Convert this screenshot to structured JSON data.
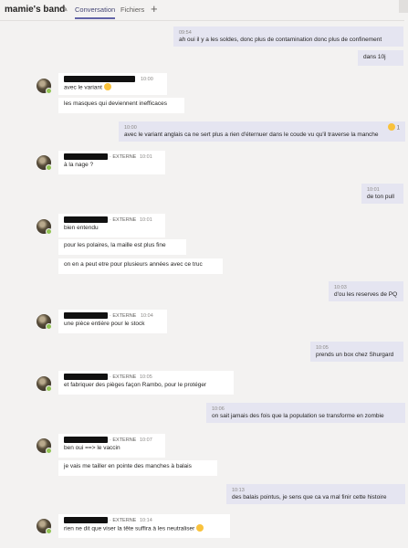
{
  "header": {
    "title": "mamie's band",
    "tabs": [
      {
        "label": "Conversation",
        "active": true
      },
      {
        "label": "Fichiers",
        "active": false
      }
    ],
    "add_tab": "+"
  },
  "messages": [
    {
      "dir": "out",
      "time": "09:54",
      "text": "ah oui il y a les soldes, donc plus de contamination donc plus de confinement"
    },
    {
      "dir": "out",
      "text": "dans 10j"
    },
    {
      "dir": "in",
      "time": "10:00",
      "text": "avec le variant",
      "emoji": "grimace-emoji"
    },
    {
      "dir": "in",
      "text": "les masques qui deviennent inefficaces"
    },
    {
      "dir": "out",
      "time": "10:00",
      "text": "avec le variant anglais ca ne sert plus a rien d'éternuer dans le coude vu qu'il traverse la manche",
      "reaction": "1"
    },
    {
      "dir": "in",
      "meta": "· EXTERNE",
      "time": "10:01",
      "text": "à la nage ?"
    },
    {
      "dir": "out",
      "time": "10:01",
      "text": "de ton pull"
    },
    {
      "dir": "in",
      "meta": "· EXTERNE",
      "time": "10:01",
      "text": "bien entendu"
    },
    {
      "dir": "in",
      "text": "pour les polaires, la maille est plus fine"
    },
    {
      "dir": "in",
      "text": "on en a peut etre pour plusieurs années avec ce truc"
    },
    {
      "dir": "out",
      "time": "10:03",
      "text": "d'ou les reserves de PQ"
    },
    {
      "dir": "in",
      "meta": "· EXTERNE",
      "time": "10:04",
      "text": "une pièce entière pour le stock"
    },
    {
      "dir": "out",
      "time": "10:05",
      "text": "prends un box chez Shurgard"
    },
    {
      "dir": "in",
      "meta": "· EXTERNE",
      "time": "10:05",
      "text": "et fabriquer des pièges façon Rambo, pour le protéger"
    },
    {
      "dir": "out",
      "time": "10:06",
      "text": "on sait jamais des fois que la population se transforme en zombie"
    },
    {
      "dir": "in",
      "meta": "· EXTERNE",
      "time": "10:07",
      "text": "ben oui ==> le vaccin"
    },
    {
      "dir": "in",
      "text": "je vais me tailler en pointe des manches à balais"
    },
    {
      "dir": "out",
      "time": "10:13",
      "text": "des balais pointus, je sens que ca va mal finir cette histoire"
    },
    {
      "dir": "in",
      "meta": "· EXTERNE",
      "time": "10:14",
      "text": "rien ne dit que viser la tête suffira à les neutraliser",
      "emoji": "smile-emoji"
    }
  ]
}
